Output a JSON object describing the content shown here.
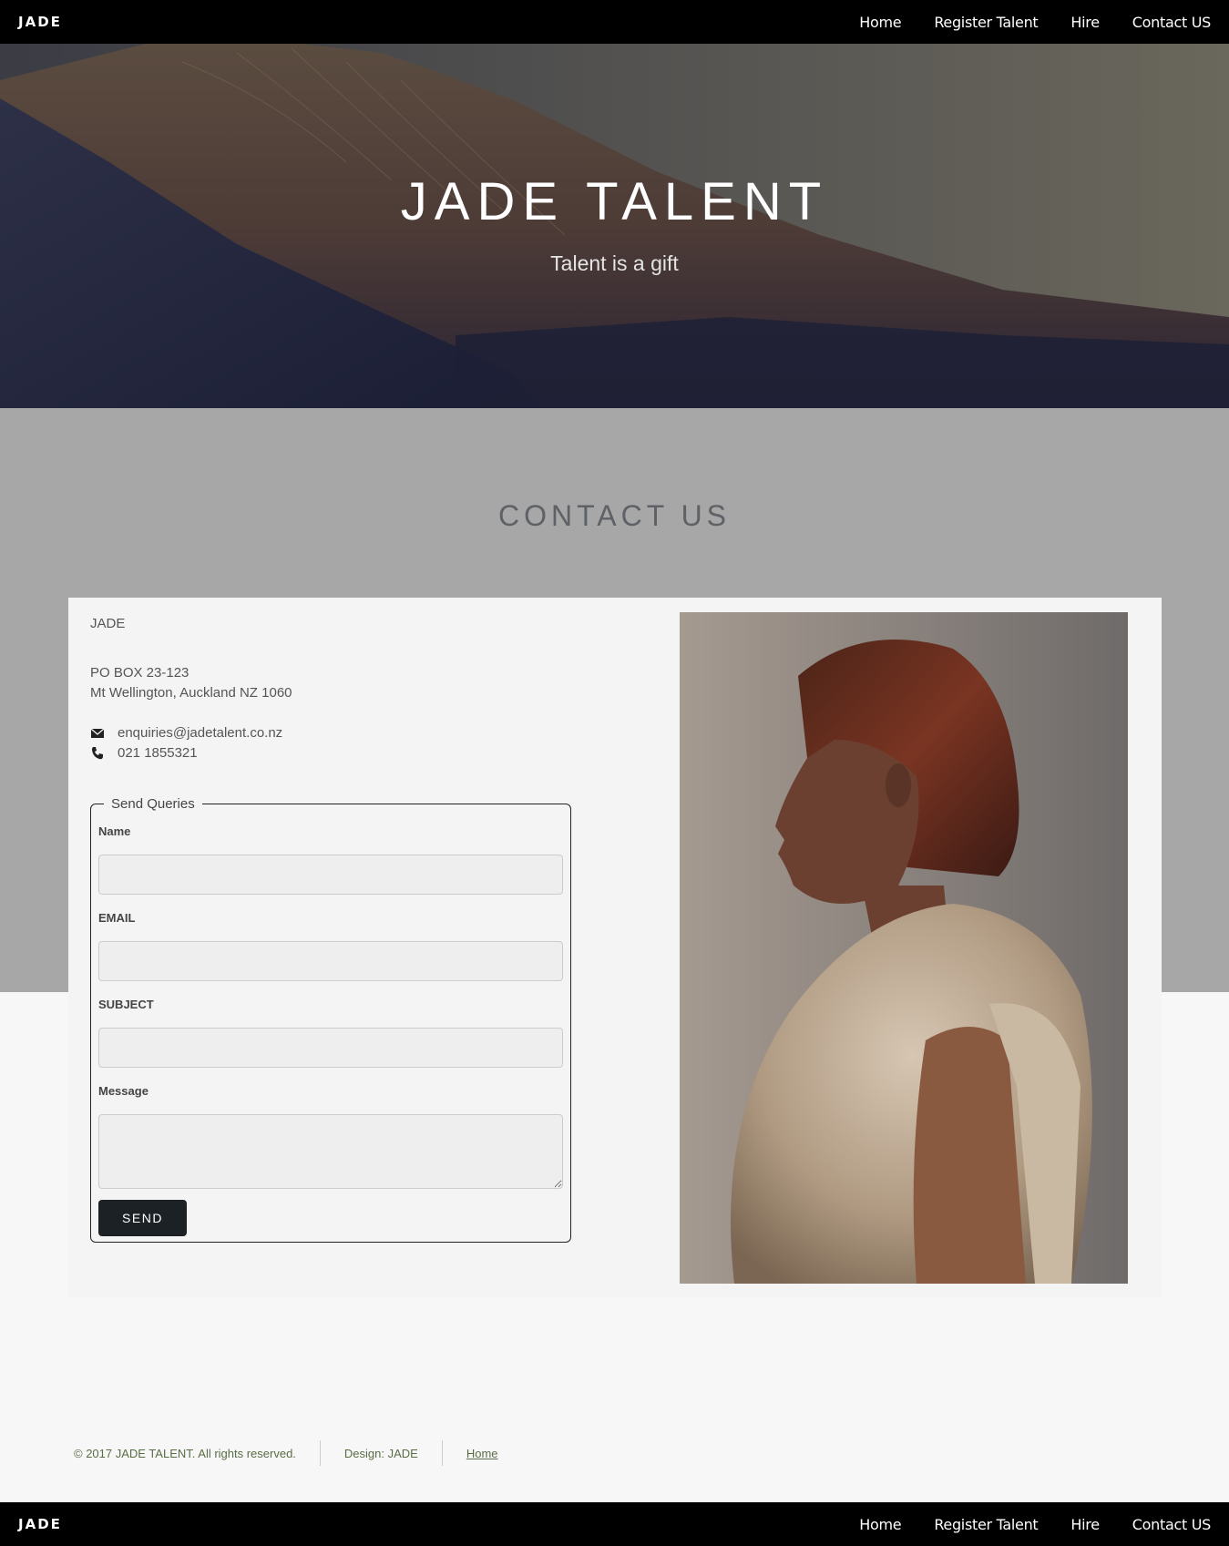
{
  "nav": {
    "brand": "JADE",
    "items": [
      "Home",
      "Register Talent",
      "Hire",
      "Contact US"
    ]
  },
  "hero": {
    "title": "JADE TALENT",
    "subtitle": "Talent is a gift"
  },
  "contact": {
    "heading": "CONTACT US",
    "company": "JADE",
    "address_line1": "PO BOX 23-123",
    "address_line2": "Mt Wellington, Auckland NZ 1060",
    "email": "enquiries@jadetalent.co.nz",
    "phone": "021 1855321"
  },
  "form": {
    "legend": "Send Queries",
    "name_label": "Name",
    "email_label": "EMAIL",
    "subject_label": "SUBJECT",
    "message_label": "Message",
    "send_label": "SEND"
  },
  "footer": {
    "copyright": "© 2017 JADE TALENT. All rights reserved.",
    "design": "Design: JADE",
    "home_link": "Home"
  },
  "icons": {
    "email": "envelope-icon",
    "phone": "phone-icon"
  }
}
